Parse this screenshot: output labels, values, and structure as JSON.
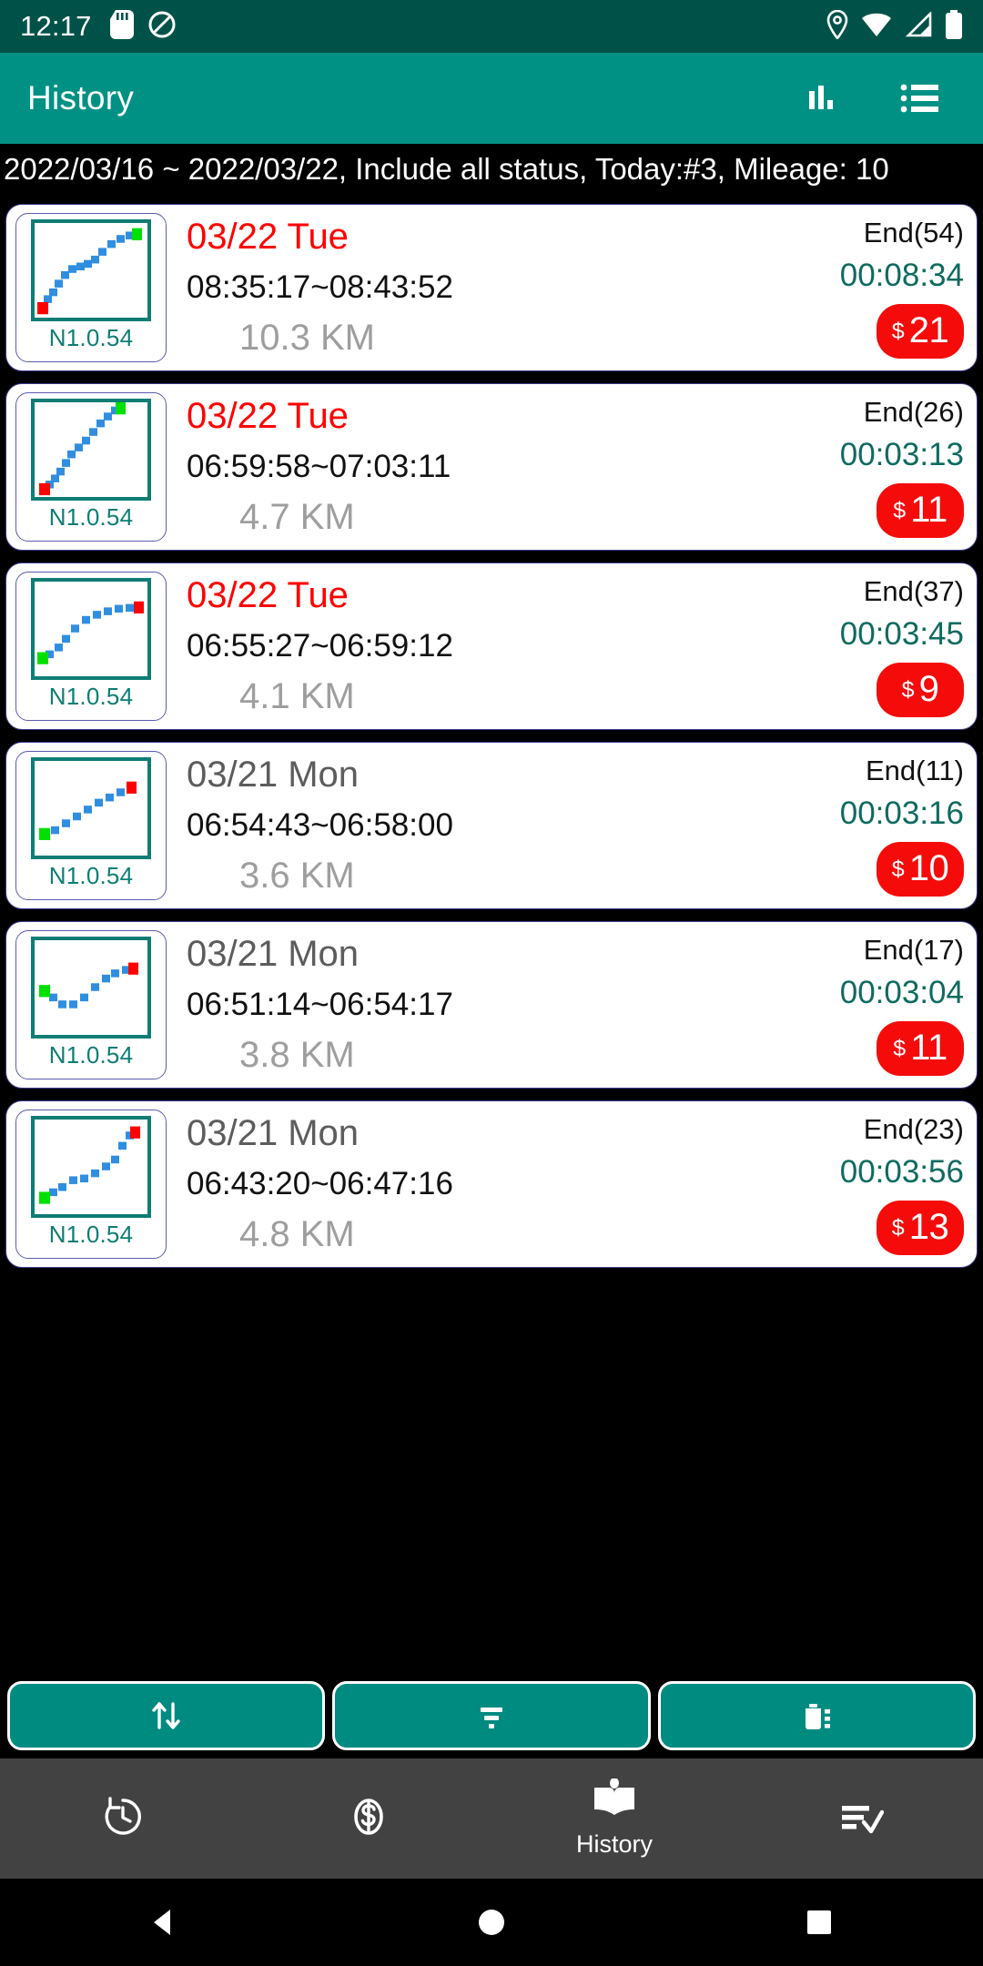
{
  "status_bar": {
    "clock": "12:17",
    "left_icons": [
      "sd-card-icon",
      "do-not-disturb-icon"
    ],
    "right_icons": [
      "location-icon",
      "wifi-icon",
      "signal-icon",
      "battery-icon"
    ]
  },
  "app_bar": {
    "title": "History",
    "actions": [
      {
        "name": "chart-icon",
        "label": "Statistics"
      },
      {
        "name": "list-icon",
        "label": "List"
      }
    ]
  },
  "summary": {
    "text": "2022/03/16 ~ 2022/03/22, Include all status, Today:#3, Mileage: 10"
  },
  "colors": {
    "primary": "#009184",
    "status_bar": "#005248",
    "accent_red": "#f60b0b",
    "date_red": "#ff0000",
    "duration_teal": "#0e6b60",
    "distance_gray": "#9e9e9e",
    "thumb_border": "#0f7d74",
    "nav_bg": "#424242"
  },
  "records": [
    {
      "thumb_label": "N1.0.54",
      "date": "03/22 Tue",
      "date_highlight": true,
      "times": "08:35:17~08:43:52",
      "distance": "10.3 KM",
      "status": "End(54)",
      "duration": "00:08:34",
      "currency": "$",
      "price": "21",
      "track": "s-curve-up",
      "start_marker": "bottom-left",
      "end_marker": "top-right"
    },
    {
      "thumb_label": "N1.0.54",
      "date": "03/22 Tue",
      "date_highlight": true,
      "times": "06:59:58~07:03:11",
      "distance": "4.7 KM",
      "status": "End(26)",
      "duration": "00:03:13",
      "currency": "$",
      "price": "11",
      "track": "steep-up",
      "start_marker": "bottom-left",
      "end_marker": "top-right"
    },
    {
      "thumb_label": "N1.0.54",
      "date": "03/22 Tue",
      "date_highlight": true,
      "times": "06:55:27~06:59:12",
      "distance": "4.1 KM",
      "status": "End(37)",
      "duration": "00:03:45",
      "currency": "$",
      "price": "9",
      "track": "rise-plateau",
      "start_marker": "left",
      "end_marker": "right"
    },
    {
      "thumb_label": "N1.0.54",
      "date": "03/21 Mon",
      "date_highlight": false,
      "times": "06:54:43~06:58:00",
      "distance": "3.6 KM",
      "status": "End(11)",
      "duration": "00:03:16",
      "currency": "$",
      "price": "10",
      "track": "gentle-up",
      "start_marker": "left",
      "end_marker": "right"
    },
    {
      "thumb_label": "N1.0.54",
      "date": "03/21 Mon",
      "date_highlight": false,
      "times": "06:51:14~06:54:17",
      "distance": "3.8 KM",
      "status": "End(17)",
      "duration": "00:03:04",
      "currency": "$",
      "price": "11",
      "track": "dip-then-up",
      "start_marker": "left",
      "end_marker": "right"
    },
    {
      "thumb_label": "N1.0.54",
      "date": "03/21 Mon",
      "date_highlight": false,
      "times": "06:43:20~06:47:16",
      "distance": "4.8 KM",
      "status": "End(23)",
      "duration": "00:03:56",
      "currency": "$",
      "price": "13",
      "track": "step-up",
      "start_marker": "bottom-left",
      "end_marker": "top-right"
    }
  ],
  "action_bar": [
    {
      "name": "sort-button",
      "icon": "sort-arrows-icon",
      "label": "Sort"
    },
    {
      "name": "filter-button",
      "icon": "filter-icon",
      "label": "Filter"
    },
    {
      "name": "delete-button",
      "icon": "delete-list-icon",
      "label": "Delete"
    }
  ],
  "bottom_nav": [
    {
      "name": "nav-recent",
      "icon": "history-clock-icon",
      "label": "",
      "selected": false
    },
    {
      "name": "nav-income",
      "icon": "dollar-coin-icon",
      "label": "",
      "selected": false
    },
    {
      "name": "nav-history",
      "icon": "book-icon",
      "label": "History",
      "selected": true
    },
    {
      "name": "nav-tasks",
      "icon": "checklist-icon",
      "label": "",
      "selected": false
    }
  ],
  "system_nav": [
    {
      "name": "back-button",
      "icon": "triangle-back-icon"
    },
    {
      "name": "home-button",
      "icon": "circle-home-icon"
    },
    {
      "name": "recents-button",
      "icon": "square-recents-icon"
    }
  ]
}
